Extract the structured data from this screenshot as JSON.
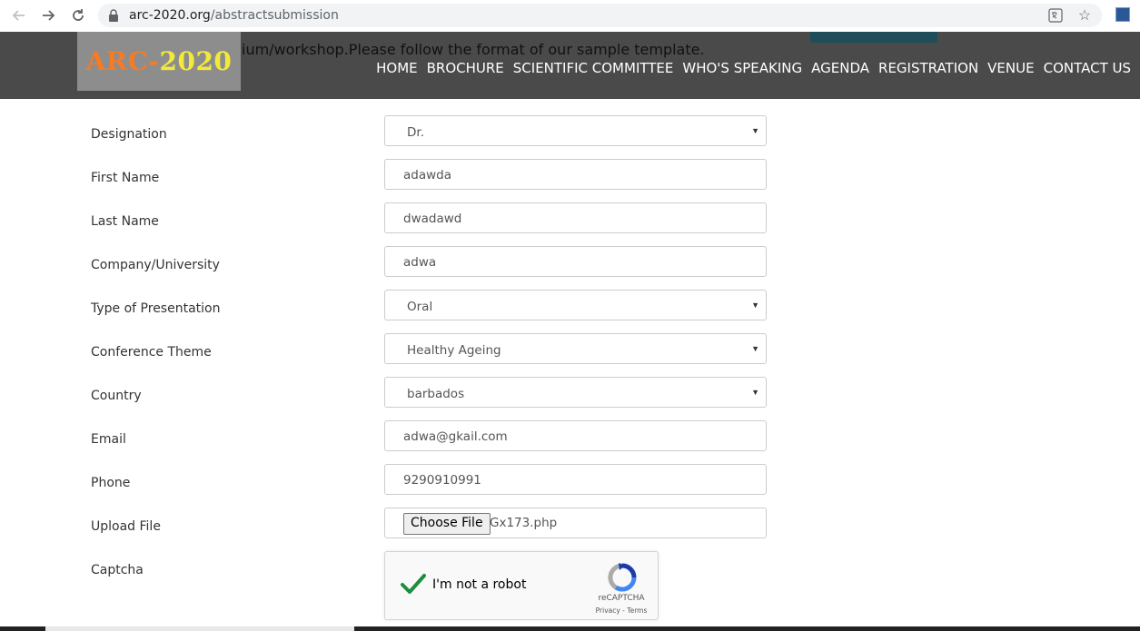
{
  "browser": {
    "url_host": "arc-2020.org",
    "url_path": "/abstractsubmission"
  },
  "header": {
    "partial_text": "ium/workshop.Please follow the format of our sample template.",
    "logo_part1": "ARC-",
    "logo_part2": "2020",
    "nav": [
      "HOME",
      "BROCHURE",
      "SCIENTIFIC COMMITTEE",
      "WHO'S SPEAKING",
      "AGENDA",
      "REGISTRATION",
      "VENUE",
      "CONTACT US"
    ]
  },
  "form": {
    "designation": {
      "label": "Designation",
      "value": "Dr."
    },
    "first_name": {
      "label": "First Name",
      "value": "adawda"
    },
    "last_name": {
      "label": "Last Name",
      "value": "dwadawd"
    },
    "company": {
      "label": "Company/University",
      "value": "adwa"
    },
    "presentation_type": {
      "label": "Type of Presentation",
      "value": "Oral"
    },
    "theme": {
      "label": "Conference Theme",
      "value": "Healthy Ageing"
    },
    "country": {
      "label": "Country",
      "value": "barbados"
    },
    "email": {
      "label": "Email",
      "value": "adwa@gkail.com"
    },
    "phone": {
      "label": "Phone",
      "value": "9290910991"
    },
    "upload": {
      "label": "Upload File",
      "button": "Choose File",
      "file_name": "Gx173.php"
    },
    "captcha": {
      "label": "Captcha",
      "text": "I'm not a robot",
      "brand": "reCAPTCHA",
      "links": "Privacy - Terms"
    }
  },
  "colors": {
    "header_bg": "#4a4a4a",
    "logo_orange": "#f57b26",
    "logo_yellow": "#f3e93a",
    "check_green": "#1e8e3e"
  }
}
